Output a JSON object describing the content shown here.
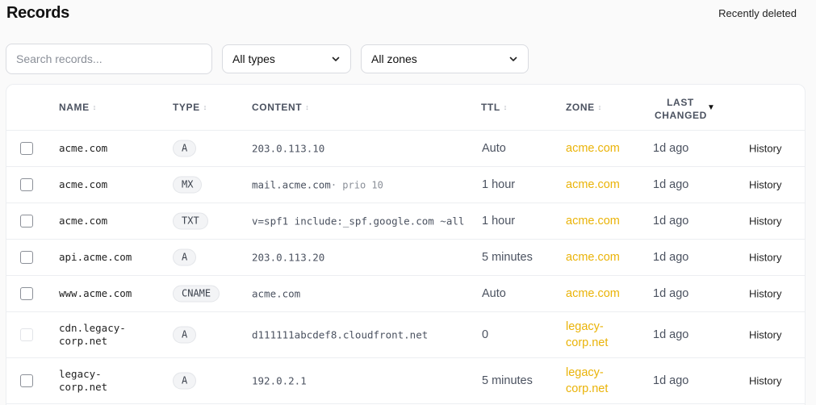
{
  "page": {
    "title": "Records",
    "recently_deleted": "Recently deleted"
  },
  "filters": {
    "search_placeholder": "Search records...",
    "types_selected": "All types",
    "zones_selected": "All zones"
  },
  "colors": {
    "zone_link": "#eab308"
  },
  "table": {
    "headers": {
      "name": "NAME",
      "type": "TYPE",
      "content": "CONTENT",
      "ttl": "TTL",
      "zone": "ZONE",
      "last_changed_1": "LAST",
      "last_changed_2": "CHANGED"
    },
    "rows": [
      {
        "name": "acme.com",
        "type": "A",
        "content": "203.0.113.10",
        "extra": "",
        "ttl": "Auto",
        "zone": "acme.com",
        "changed": "1d ago",
        "action": "History",
        "disabled": false
      },
      {
        "name": "acme.com",
        "type": "MX",
        "content": "mail.acme.com",
        "extra": "· prio 10",
        "ttl": "1 hour",
        "zone": "acme.com",
        "changed": "1d ago",
        "action": "History",
        "disabled": false
      },
      {
        "name": "acme.com",
        "type": "TXT",
        "content": "v=spf1 include:_spf.google.com ~all",
        "extra": "",
        "ttl": "1 hour",
        "zone": "acme.com",
        "changed": "1d ago",
        "action": "History",
        "disabled": false
      },
      {
        "name": "api.acme.com",
        "type": "A",
        "content": "203.0.113.20",
        "extra": "",
        "ttl": "5 minutes",
        "zone": "acme.com",
        "changed": "1d ago",
        "action": "History",
        "disabled": false
      },
      {
        "name": "www.acme.com",
        "type": "CNAME",
        "content": "acme.com",
        "extra": "",
        "ttl": "Auto",
        "zone": "acme.com",
        "changed": "1d ago",
        "action": "History",
        "disabled": false
      },
      {
        "name": "cdn.legacy-corp.net",
        "type": "A",
        "content": "d111111abcdef8.cloudfront.net",
        "extra": "",
        "ttl": "0",
        "zone": "legacy-corp.net",
        "changed": "1d ago",
        "action": "History",
        "disabled": true
      },
      {
        "name": "legacy-corp.net",
        "type": "A",
        "content": "192.0.2.1",
        "extra": "",
        "ttl": "5 minutes",
        "zone": "legacy-corp.net",
        "changed": "1d ago",
        "action": "History",
        "disabled": false
      }
    ]
  }
}
